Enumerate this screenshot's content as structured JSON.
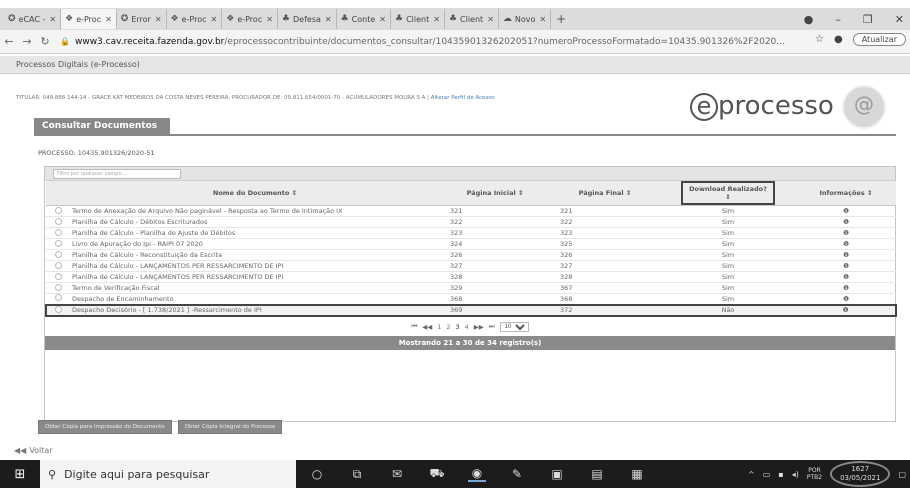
{
  "browser": {
    "tabs": [
      {
        "icon": "✪",
        "label": "eCAC -"
      },
      {
        "icon": "❖",
        "label": "e-Proc",
        "active": true
      },
      {
        "icon": "✪",
        "label": "Error"
      },
      {
        "icon": "❖",
        "label": "e-Proc"
      },
      {
        "icon": "❖",
        "label": "e-Proc"
      },
      {
        "icon": "♣",
        "label": "Defesa"
      },
      {
        "icon": "♣",
        "label": "Conte"
      },
      {
        "icon": "♣",
        "label": "Client"
      },
      {
        "icon": "♣",
        "label": "Client"
      },
      {
        "icon": "☁",
        "label": "Novo"
      }
    ],
    "new_tab": "+",
    "url_host": "www3.cav.receita.fazenda.gov.br",
    "url_path": "/eprocessocontribuinte/documentos_consultar/10435901326202051?numeroProcessoFormatado=10435.901326%2F2020...",
    "update_label": "Atualizar"
  },
  "site": {
    "bar_title": "Processos Digitais (e-Processo)",
    "titular": "TITULAR: 049.866.144-14 - GRACE KAT MEDEIROS DA COSTA NEVES PEREIRA, PROCURADOR DE: 09.811.654/0001-70 - ACUMULADORES MOURA S A |",
    "alterar": "Alterar Perfil de Acesso",
    "logo_e": "e",
    "logo_text": "processo",
    "section_tab": "Consultar Documentos",
    "processo_label": "PROCESSO: 10435.901326/2020-51"
  },
  "table": {
    "filter_placeholder": "Filtro por qualquer campo...",
    "headers": {
      "name": "Nome do Documento ⇕",
      "start": "Página Inicial ⇕",
      "end": "Página Final ⇕",
      "download": "Download Realizado?",
      "download_sort": "⇕",
      "info": "Informações ⇕"
    },
    "rows": [
      {
        "name": "Termo de Anexação de Arquivo Não paginável - Resposta ao Termo de Intimação IX",
        "start": "321",
        "end": "321",
        "download": "Sim",
        "info": "❶"
      },
      {
        "name": "Planilha de Cálculo - Débitos Escriturados",
        "start": "322",
        "end": "322",
        "download": "Sim",
        "info": "❶"
      },
      {
        "name": "Planilha de Cálculo - Planilha de Ajuste de Débitos",
        "start": "323",
        "end": "323",
        "download": "Sim",
        "info": "❶"
      },
      {
        "name": "Livro de Apuração do Ipi - RAIPI 07 2020",
        "start": "324",
        "end": "325",
        "download": "Sim",
        "info": "❶"
      },
      {
        "name": "Planilha de Cálculo - Reconstituição da Escrita",
        "start": "326",
        "end": "326",
        "download": "Sim",
        "info": "❶"
      },
      {
        "name": "Planilha de Cálculo - LANÇAMENTOS PER RESSARCIMENTO DE IPI",
        "start": "327",
        "end": "327",
        "download": "Sim",
        "info": "❶"
      },
      {
        "name": "Planilha de Cálculo - LANÇAMENTOS PER RESSARCIMENTO DE IPI",
        "start": "328",
        "end": "328",
        "download": "Sim",
        "info": "❶"
      },
      {
        "name": "Termo de Verificação Fiscal",
        "start": "329",
        "end": "367",
        "download": "Sim",
        "info": "❶"
      },
      {
        "name": "Despacho de Encaminhamento",
        "start": "368",
        "end": "368",
        "download": "Sim",
        "info": "❶"
      },
      {
        "name": "Despacho Decisório - [ 1.738/2021 ] -Ressarcimento de IPI",
        "start": "369",
        "end": "372",
        "download": "Não",
        "info": "❶",
        "highlight": true
      }
    ],
    "pager": {
      "first": "⏮",
      "prev": "◀◀",
      "pages": [
        "1",
        "2",
        "3",
        "4"
      ],
      "current_page": "3",
      "next": "▶▶",
      "last": "⏭",
      "per_page": "10"
    },
    "records_text": "Mostrando 21 a 30 de 34 registro(s)"
  },
  "buttons": {
    "print_copy": "Obter Cópia para Impressão do Documento",
    "full_copy": "Obter Cópia Integral do Processo"
  },
  "voltar": "Voltar",
  "taskbar": {
    "search_placeholder": "Digite aqui para pesquisar",
    "lang": "POR",
    "layout": "PTB2",
    "time": "1627",
    "date": "03/05/2021"
  }
}
